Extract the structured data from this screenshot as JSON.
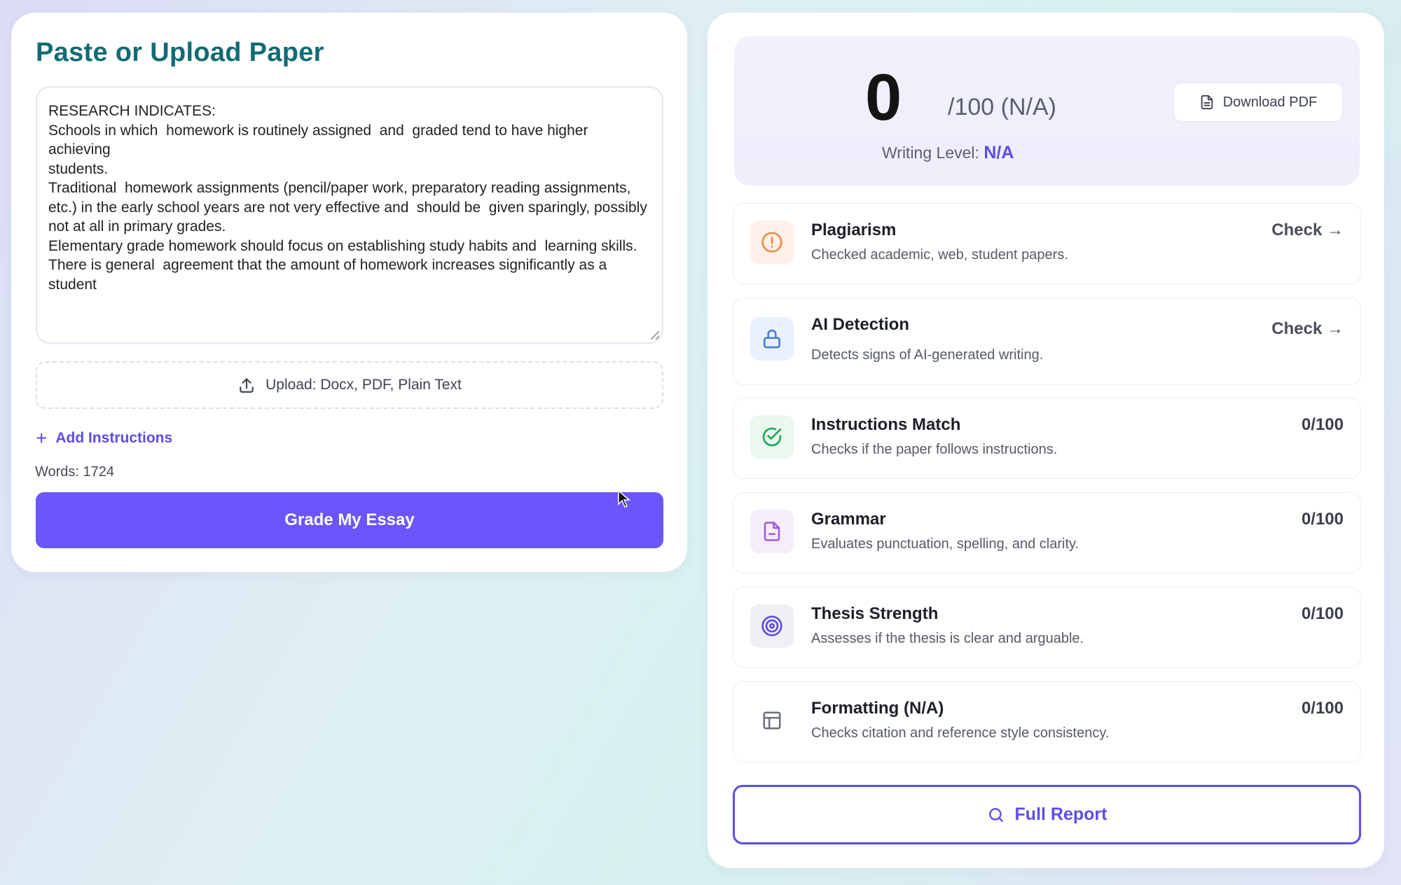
{
  "left": {
    "title": "Paste or Upload Paper",
    "essay_text": "RESEARCH INDICATES:\nSchools in which  homework is routinely assigned  and  graded tend to have higher achieving\nstudents.\nTraditional  homework assignments (pencil/paper work, preparatory reading assignments,\netc.) in the early school years are not very effective and  should be  given sparingly, possibly\nnot at all in primary grades.\nElementary grade homework should focus on establishing study habits and  learning skills.\nThere is general  agreement that the amount of homework increases significantly as a student",
    "upload_label": "Upload: Docx, PDF, Plain Text",
    "add_instructions_label": "Add Instructions",
    "words_label": "Words: 1724",
    "grade_button_label": "Grade My Essay"
  },
  "score": {
    "value": "0",
    "out_of": "/100 (N/A)",
    "writing_level_label": "Writing Level:",
    "writing_level_value": "N/A",
    "download_label": "Download PDF"
  },
  "metrics": [
    {
      "title": "Plagiarism",
      "desc": "Checked academic, web, student papers.",
      "right": "Check →",
      "icon": "alert-circle-icon",
      "color": "#f08a4b",
      "bg": "#fff1ea"
    },
    {
      "title": "AI Detection",
      "desc": "Detects signs of AI-generated writing.",
      "right": "Check →",
      "icon": "lock-icon",
      "color": "#4a7fe0",
      "bg": "#eaf1fd"
    },
    {
      "title": "Instructions Match",
      "desc": "Checks if the paper follows instructions.",
      "right": "0/100",
      "icon": "check-circle-icon",
      "color": "#22a856",
      "bg": "#eaf8ef"
    },
    {
      "title": "Grammar",
      "desc": "Evaluates punctuation, spelling, and clarity.",
      "right": "0/100",
      "icon": "document-icon",
      "color": "#a455e3",
      "bg": "#f6edfc"
    },
    {
      "title": "Thesis Strength",
      "desc": "Assesses if the thesis is clear and arguable.",
      "right": "0/100",
      "icon": "target-icon",
      "color": "#5b4de6",
      "bg": "#f0f0f4"
    },
    {
      "title": "Formatting (N/A)",
      "desc": "Checks citation and reference style consistency.",
      "right": "0/100",
      "icon": "layout-icon",
      "color": "#6b6f7a",
      "bg": "#ffffff"
    }
  ],
  "full_report_label": "Full Report"
}
